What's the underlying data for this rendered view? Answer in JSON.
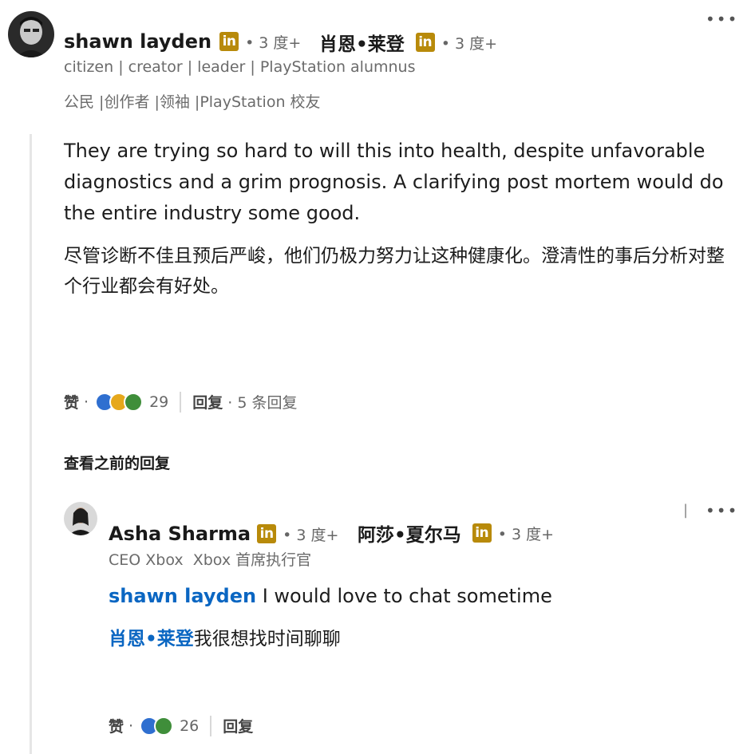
{
  "post": {
    "author_name": "shawn layden",
    "author_name_zh": "肖恩•莱登",
    "degree": "• 3 度+",
    "headline": "citizen | creator | leader | PlayStation alumnus",
    "headline_zh": "公民 |创作者 |领袖 |PlayStation 校友",
    "body_en": "They are trying so hard to will this into health, despite unfavorable diagnostics and a grim prognosis. A clarifying post mortem would do the entire industry some good.",
    "body_zh": "尽管诊断不佳且预后严峻，他们仍极力努力让这种健康化。澄清性的事后分析对整个行业都会有好处。",
    "like_label": "赞",
    "sep": "·",
    "reaction_count": "29",
    "reply_label": "回复",
    "replies_text": "· 5 条回复",
    "more_icon": "more-horizontal-icon",
    "badge": "in"
  },
  "view_previous": "查看之前的回复",
  "reply": {
    "author_name": "Asha Sharma",
    "author_name_zh": "阿莎•夏尔马",
    "degree": "• 3 度+",
    "headline": "CEO Xbox  Xbox 首席执行官",
    "mention": "shawn layden",
    "body_en": "I would love to chat sometime",
    "mention_zh": "肖恩•莱登",
    "body_zh": "我很想找时间聊聊",
    "like_label": "赞",
    "sep": "·",
    "reaction_count": "26",
    "reply_label": "回复",
    "stray_mark": "|",
    "badge": "in"
  },
  "colors": {
    "accent": "#0a66c2",
    "badge": "#b88a0a"
  }
}
